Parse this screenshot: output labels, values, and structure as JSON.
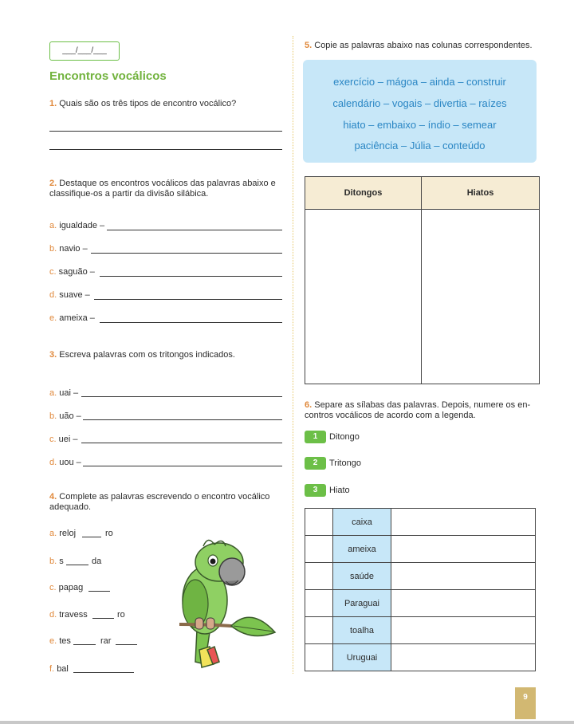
{
  "header": {
    "date_placeholder": "___/___/___",
    "title": "Encontros vocálicos"
  },
  "q1": {
    "number": "1.",
    "text": "Quais são os três tipos de encontro vocálico?"
  },
  "q2": {
    "number": "2.",
    "text_line1": "Destaque os encontros vocálicos das palavras abaixo e",
    "text_line2": "classifique-os a partir da divisão silábica.",
    "items": [
      {
        "letter": "a.",
        "word": "igualdade –"
      },
      {
        "letter": "b.",
        "word": "navio –"
      },
      {
        "letter": "c.",
        "word": "saguão –"
      },
      {
        "letter": "d.",
        "word": "suave –"
      },
      {
        "letter": "e.",
        "word": "ameixa –"
      }
    ]
  },
  "q3": {
    "number": "3.",
    "text": "Escreva palavras com os tritongos indicados.",
    "items": [
      {
        "letter": "a.",
        "word": "uai –"
      },
      {
        "letter": "b.",
        "word": "uão –"
      },
      {
        "letter": "c.",
        "word": "uei –"
      },
      {
        "letter": "d.",
        "word": "uou –"
      }
    ]
  },
  "q4": {
    "number": "4.",
    "text_line1": "Complete as palavras escrevendo o encontro vocálico",
    "text_line2": "adequado.",
    "items": [
      {
        "letter": "a.",
        "parts": [
          "reloj",
          "ro"
        ]
      },
      {
        "letter": "b.",
        "parts": [
          "s",
          "da"
        ]
      },
      {
        "letter": "c.",
        "parts": [
          "papag",
          ""
        ]
      },
      {
        "letter": "d.",
        "parts": [
          "travess",
          "ro"
        ]
      },
      {
        "letter": "e.",
        "parts": [
          "tes",
          "rar"
        ]
      },
      {
        "letter": "f.",
        "parts": [
          "bal",
          ""
        ]
      }
    ]
  },
  "q5": {
    "number": "5.",
    "text": "Copie as palavras abaixo nas colunas correspondentes.",
    "word_lines": [
      "exercício – mágoa – ainda – construir",
      "calendário – vogais – divertia – raízes",
      "hiato – embaixo – índio – semear",
      "paciência – Júlia – conteúdo"
    ],
    "columns": [
      "Ditongos",
      "Hiatos"
    ]
  },
  "q6": {
    "number": "6.",
    "text_line1": "Separe as sílabas das palavras. Depois, numere os en-",
    "text_line2": "contros vocálicos de acordo com a legenda.",
    "legend": [
      {
        "num": "1",
        "label": "Ditongo"
      },
      {
        "num": "2",
        "label": "Tritongo"
      },
      {
        "num": "3",
        "label": "Hiato"
      }
    ],
    "words": [
      "caixa",
      "ameixa",
      "saúde",
      "Paraguai",
      "toalha",
      "Uruguai"
    ]
  },
  "page_number": "9",
  "colors": {
    "accent_green": "#72b33e",
    "accent_orange": "#e0883a",
    "word_blue": "#2a86c4",
    "box_blue": "#c7e7f8"
  }
}
